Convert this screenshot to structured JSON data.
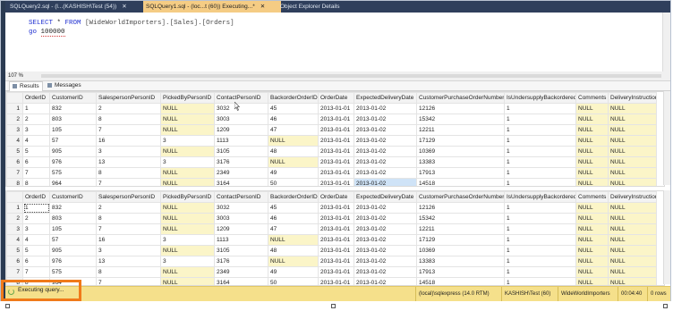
{
  "tabs": [
    {
      "label": "SQLQuery2.sql - (l...(KASHISH\\Test (54))",
      "close": "✕"
    },
    {
      "label": "SQLQuery1.sql - (loc...t (60)) Executing...*",
      "close": "✕"
    },
    {
      "label": "Object Explorer Details",
      "close": ""
    }
  ],
  "editor": {
    "line1": {
      "kw": "SELECT",
      "rest": " * ",
      "kw2": "FROM",
      "tail": " [WideWorldImporters].[Sales].[Orders]"
    },
    "line2": {
      "kw": "go",
      "num": "100000"
    }
  },
  "zoom": "107 %",
  "result_tabs": {
    "results": "Results",
    "messages": "Messages"
  },
  "grid": {
    "columns": [
      "",
      "OrderID",
      "CustomerID",
      "SalespersonPersonID",
      "PickedByPersonID",
      "ContactPersonID",
      "BackorderOrderID",
      "OrderDate",
      "ExpectedDeliveryDate",
      "CustomerPurchaseOrderNumber",
      "IsUndersupplyBackordered",
      "Comments",
      "DeliveryInstructions"
    ],
    "rows": [
      [
        "1",
        "1",
        "832",
        "2",
        "NULL",
        "3032",
        "45",
        "2013-01-01",
        "2013-01-02",
        "12126",
        "1",
        "NULL",
        "NULL"
      ],
      [
        "2",
        "2",
        "803",
        "8",
        "NULL",
        "3003",
        "46",
        "2013-01-01",
        "2013-01-02",
        "15342",
        "1",
        "NULL",
        "NULL"
      ],
      [
        "3",
        "3",
        "105",
        "7",
        "NULL",
        "1209",
        "47",
        "2013-01-01",
        "2013-01-02",
        "12211",
        "1",
        "NULL",
        "NULL"
      ],
      [
        "4",
        "4",
        "57",
        "16",
        "3",
        "1113",
        "NULL",
        "2013-01-01",
        "2013-01-02",
        "17129",
        "1",
        "NULL",
        "NULL"
      ],
      [
        "5",
        "5",
        "905",
        "3",
        "NULL",
        "3105",
        "48",
        "2013-01-01",
        "2013-01-02",
        "10369",
        "1",
        "NULL",
        "NULL"
      ],
      [
        "6",
        "6",
        "976",
        "13",
        "3",
        "3176",
        "NULL",
        "2013-01-01",
        "2013-01-02",
        "13383",
        "1",
        "NULL",
        "NULL"
      ],
      [
        "7",
        "7",
        "575",
        "8",
        "NULL",
        "2349",
        "49",
        "2013-01-01",
        "2013-01-02",
        "17913",
        "1",
        "NULL",
        "NULL"
      ],
      [
        "8",
        "8",
        "964",
        "7",
        "NULL",
        "3164",
        "50",
        "2013-01-01",
        "2013-01-02",
        "14518",
        "1",
        "NULL",
        "NULL"
      ]
    ]
  },
  "status": {
    "executing": "Executing query...",
    "server": "(local)\\sqlexpress (14.0 RTM)",
    "user": "KASHISH\\Test (60)",
    "database": "WideWorldImporters",
    "elapsed": "00:04:40",
    "rows": "0 rows"
  },
  "colors": {
    "status_bar": "#f5e08b",
    "highlight_box": "#f07a1a",
    "active_tab": "#f5cc84",
    "null_cell": "#fbf5c8"
  }
}
